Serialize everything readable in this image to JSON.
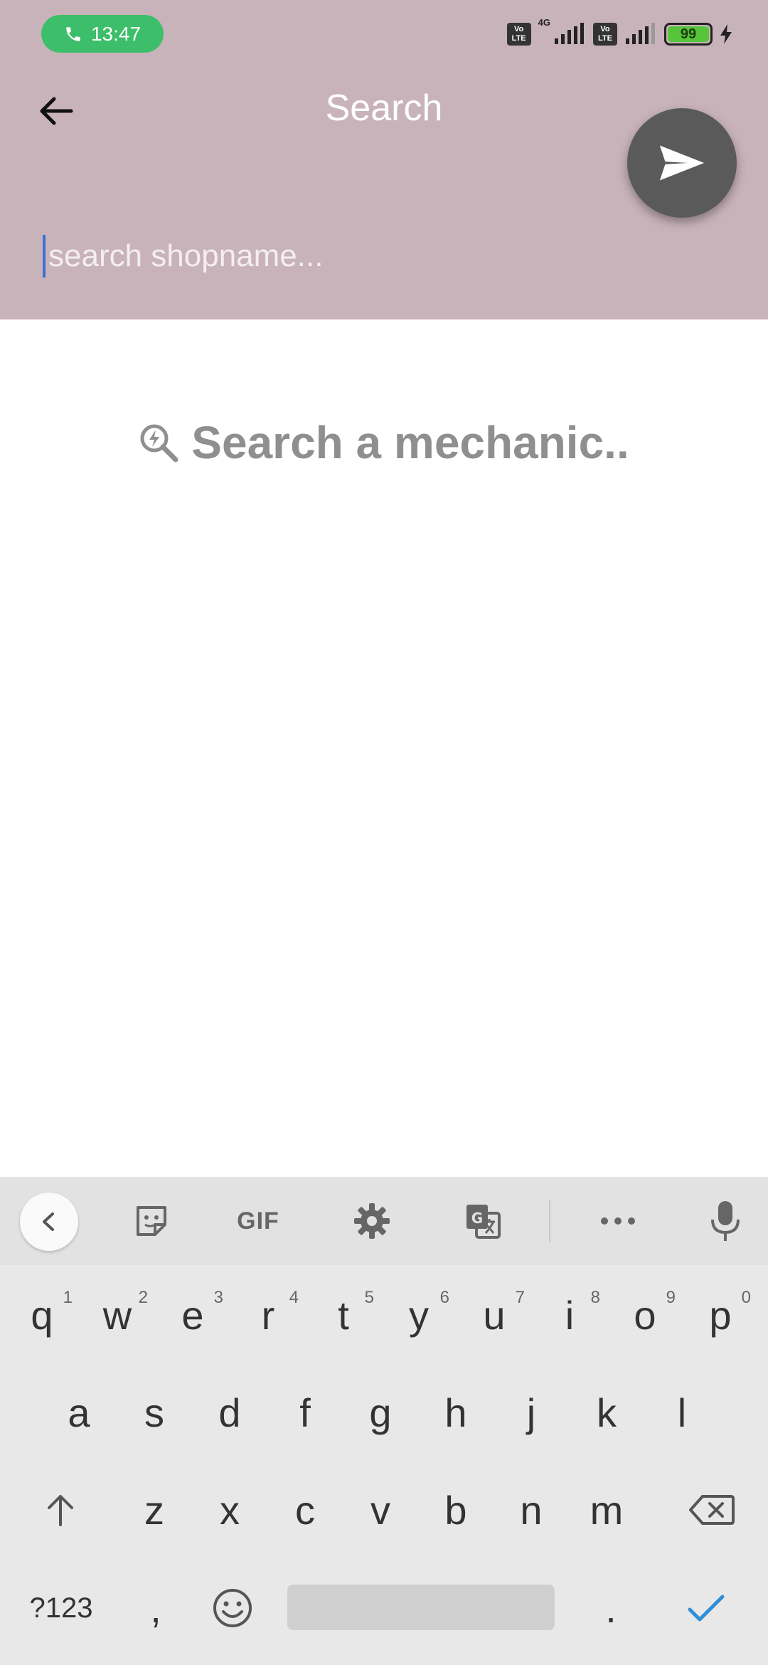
{
  "status_bar": {
    "call_time": "13:47",
    "volte_1": "Vo LTE",
    "network": "4G",
    "volte_2": "Vo LTE",
    "battery": "99"
  },
  "header": {
    "title": "Search",
    "search_placeholder": "search shopname..."
  },
  "empty_state": {
    "text": "Search a mechanic.."
  },
  "keyboard": {
    "toolbar_gif": "GIF",
    "row1": [
      {
        "key": "q",
        "hint": "1"
      },
      {
        "key": "w",
        "hint": "2"
      },
      {
        "key": "e",
        "hint": "3"
      },
      {
        "key": "r",
        "hint": "4"
      },
      {
        "key": "t",
        "hint": "5"
      },
      {
        "key": "y",
        "hint": "6"
      },
      {
        "key": "u",
        "hint": "7"
      },
      {
        "key": "i",
        "hint": "8"
      },
      {
        "key": "o",
        "hint": "9"
      },
      {
        "key": "p",
        "hint": "0"
      }
    ],
    "row2": [
      "a",
      "s",
      "d",
      "f",
      "g",
      "h",
      "j",
      "k",
      "l"
    ],
    "row3": [
      "z",
      "x",
      "c",
      "v",
      "b",
      "n",
      "m"
    ],
    "symbols_key": "?123",
    "comma_key": ",",
    "period_key": "."
  },
  "colors": {
    "appbar": "#c9b3ba",
    "fab": "#5a5a5a",
    "call_pill": "#3cbe6a",
    "enter_check": "#2e8fd8"
  }
}
